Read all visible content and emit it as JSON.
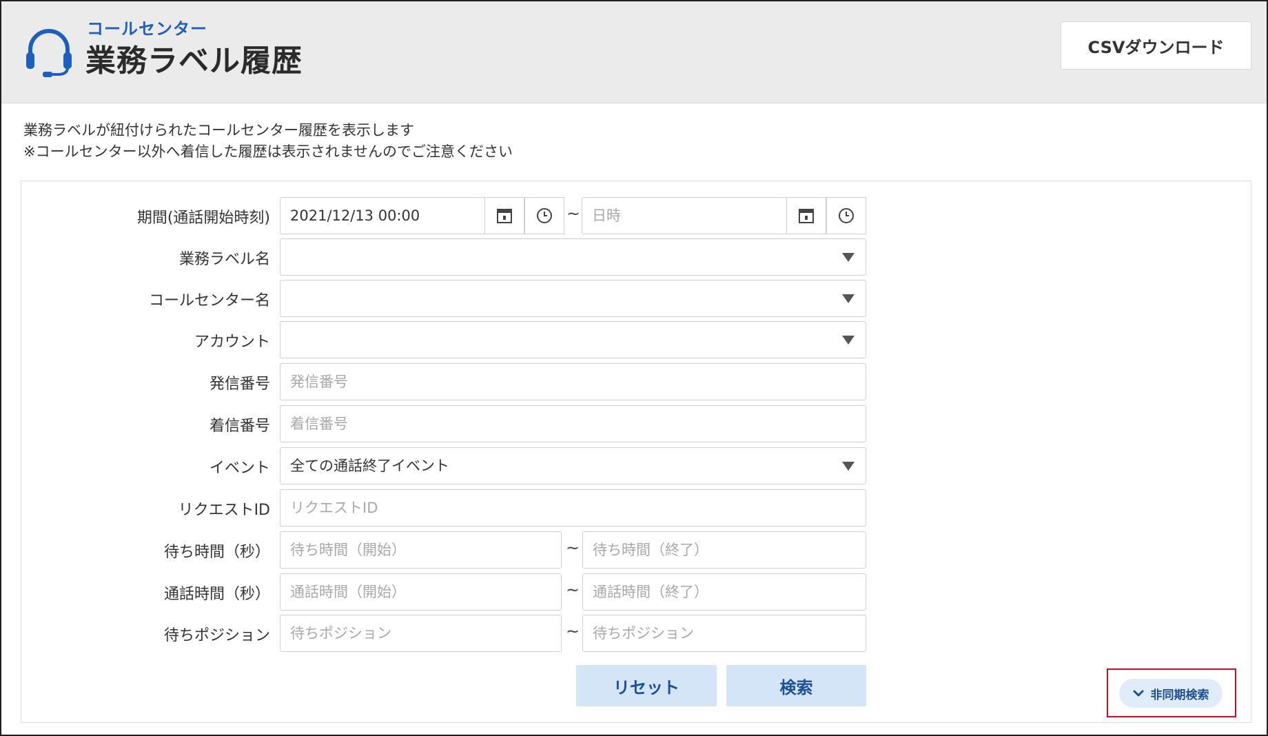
{
  "header": {
    "subtitle": "コールセンター",
    "title": "業務ラベル履歴",
    "csv_button": "CSVダウンロード",
    "accent_color": "#1d5fc0"
  },
  "description": {
    "line1": "業務ラベルが紐付けられたコールセンター履歴を表示します",
    "line2": "※コールセンター以外へ着信した履歴は表示されませんのでご注意ください"
  },
  "form": {
    "period": {
      "label": "期間(通話開始時刻)",
      "start_value": "2021/12/13 00:00",
      "end_placeholder": "日時",
      "separator": "~"
    },
    "business_label": {
      "label": "業務ラベル名",
      "value": ""
    },
    "call_center": {
      "label": "コールセンター名",
      "value": ""
    },
    "account": {
      "label": "アカウント",
      "value": ""
    },
    "caller_number": {
      "label": "発信番号",
      "placeholder": "発信番号"
    },
    "callee_number": {
      "label": "着信番号",
      "placeholder": "着信番号"
    },
    "event": {
      "label": "イベント",
      "value": "全ての通話終了イベント"
    },
    "request_id": {
      "label": "リクエストID",
      "placeholder": "リクエストID"
    },
    "wait_time": {
      "label": "待ち時間（秒）",
      "start_placeholder": "待ち時間（開始）",
      "end_placeholder": "待ち時間（終了）",
      "separator": "~"
    },
    "talk_time": {
      "label": "通話時間（秒）",
      "start_placeholder": "通話時間（開始）",
      "end_placeholder": "通話時間（終了）",
      "separator": "~"
    },
    "wait_position": {
      "label": "待ちポジション",
      "start_placeholder": "待ちポジション",
      "end_placeholder": "待ちポジション",
      "separator": "~"
    }
  },
  "buttons": {
    "reset": "リセット",
    "search": "検索",
    "async_search": "非同期検索"
  },
  "icons": {
    "header": "headset-icon",
    "calendar": "calendar-icon",
    "clock": "clock-icon",
    "dropdown": "caret-down-icon",
    "async": "chevron-down-icon"
  }
}
